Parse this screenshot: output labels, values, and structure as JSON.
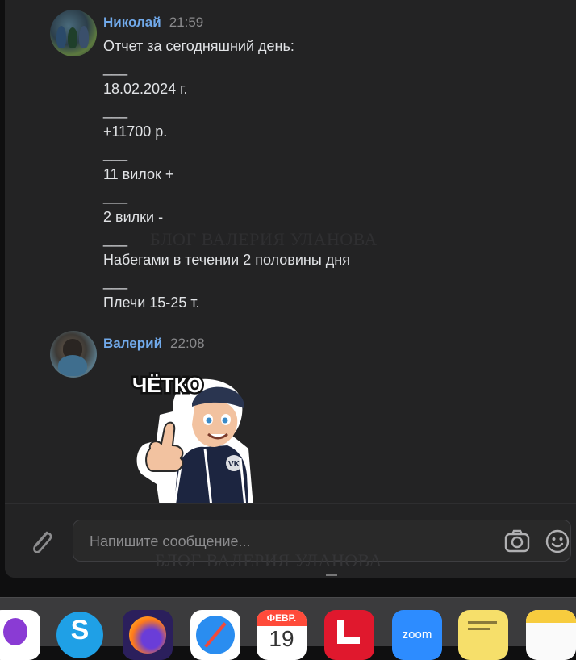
{
  "messages": [
    {
      "author": "Николай",
      "time": "21:59",
      "lines": [
        "Отчет за сегодняшний день:",
        "___",
        "18.02.2024 г.",
        "___",
        "+11700 р.",
        "___",
        "11 вилок +",
        "___",
        "2 вилки -",
        "___",
        "Набегами в течении 2 половины дня",
        "___",
        "Плечи 15-25 т."
      ]
    },
    {
      "author": "Валерий",
      "time": "22:08",
      "sticker": {
        "caption": "ЧЁТКО",
        "badge": "VK"
      }
    }
  ],
  "watermark": "БЛОГ ВАЛЕРИЯ УЛАНОВА",
  "composer": {
    "placeholder": "Напишите сообщение..."
  },
  "dock": {
    "calendar_month": "ФЕВР.",
    "calendar_day": "19",
    "zoom_label": "zoom",
    "icons": [
      "podcasts-icon",
      "skype-icon",
      "firefox-icon",
      "safari-icon",
      "calendar-icon",
      "linkedin-like-icon",
      "zoom-icon",
      "stickies-icon",
      "notes-icon"
    ]
  },
  "colors": {
    "author": "#71aaeb",
    "text": "#e1e3e6",
    "background": "#232324"
  }
}
